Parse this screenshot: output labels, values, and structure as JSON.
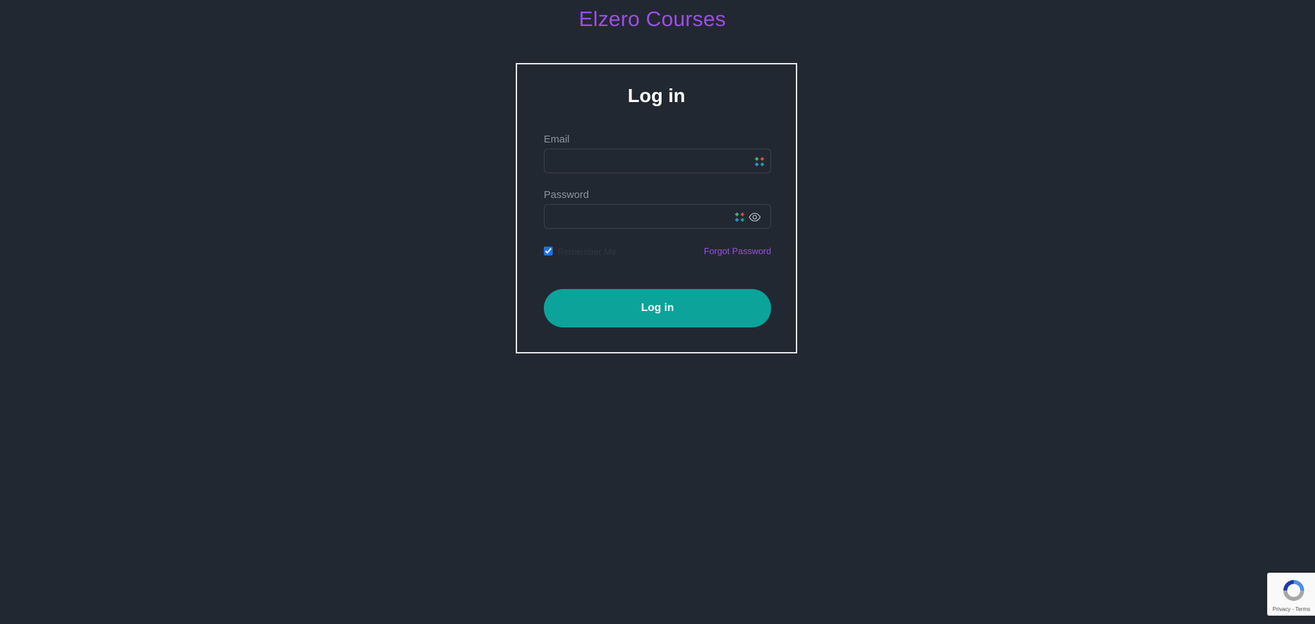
{
  "site": {
    "title": "Elzero Courses",
    "accent_color": "#9b4ee6"
  },
  "login_form": {
    "title": "Log in",
    "email_label": "Email",
    "email_value": "",
    "password_label": "Password",
    "password_value": "",
    "remember_label": "Remember Me",
    "remember_checked": true,
    "forgot_label": "Forgot Password",
    "submit_label": "Log in",
    "button_color": "#0ba39a"
  },
  "recaptcha": {
    "privacy_label": "Privacy",
    "separator": " - ",
    "terms_label": "Terms"
  },
  "icons": {
    "password_manager": "password-manager-icon",
    "show_password": "eye-icon",
    "recaptcha": "recaptcha-logo-icon"
  }
}
